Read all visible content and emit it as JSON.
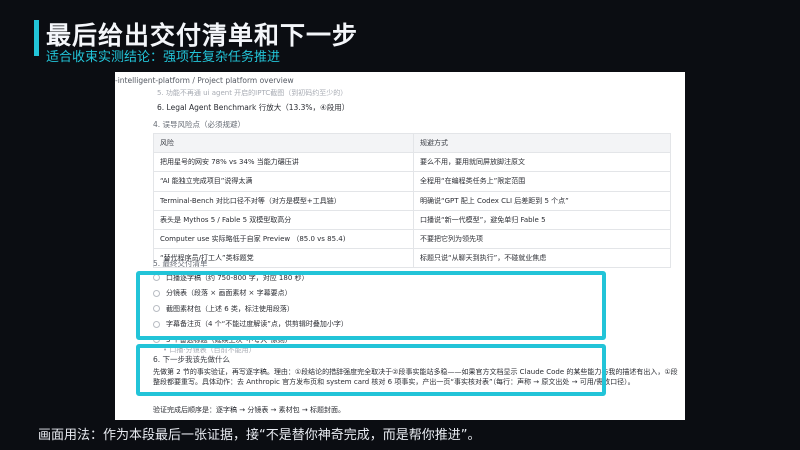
{
  "slide": {
    "title": "最后给出交付清单和下一步",
    "subtitle": "适合收束实测结论：强项在复杂任务推进",
    "caption": "画面用法：作为本段最后一张证据，接“不是替你神奇完成，而是帮你推进”。",
    "accent_color": "#22c4d8",
    "background_color": "#0b0d12"
  },
  "doc": {
    "breadcrumb": "-intelligent-platform / Project platform overview",
    "faded_line": "5. 功能不再通 ui agent 开启的IPTC截图（到初码约至少的）",
    "item6": "6. Legal Agent Benchmark 行放大（13.3%，④段用）",
    "section4_heading": "4. 误导风险点（必须规避）",
    "risk_table": {
      "headers": [
        "风险",
        "规避方式"
      ],
      "rows": [
        [
          "把用星号的网安 78% vs 34% 当能力碾压讲",
          "要么不用，要用就同屏放脚注原文"
        ],
        [
          "“AI 能独立完成项目”说得太满",
          "全程用“在编程类任务上”限定范围"
        ],
        [
          "Terminal-Bench 对比口径不对等（对方是模型+工具链）",
          "明确说“GPT 配上 Codex CLI 后差距到 5 个点”"
        ],
        [
          "表头是 Mythos 5 / Fable 5 双模型取高分",
          "口播说“新一代模型”，避免单归 Fable 5"
        ],
        [
          "Computer use 实际略低于自家 Preview （85.0 vs 85.4)",
          "不要把它列为领先项"
        ],
        [
          "“替代程序员/打工人”类标题党",
          "标题只说“从聊天到执行”，不碰就业焦虑"
        ]
      ]
    },
    "section5_heading": "5. 最终交付清单",
    "deliverables": [
      "口播逐字稿（约 750-800 字，对应 180 秒）",
      "分镜表（段落 × 画面素材 × 字幕要点）",
      "截图素材包（上述 6 类，标注使用段落）",
      "字幕备注页（4 个“不能过度解读”点，供剪辑时叠加小字）",
      "3 个备选标题（延续上次“不夸大”原则）"
    ],
    "below_item": "• 口播·分镜表（目前不能用）",
    "section6_heading": "6. 下一步我该先做什么",
    "paragraph": "先做第 2 节的事实验证，再写逐字稿。理由：①段结论的措辞强度完全取决于②段事实能站多稳——如果官方文档显示 Claude Code 的某些能力与我的描述有出入，①段整段都要重写。具体动作：去 Anthropic 官方发布页和 system card 核对 6 项事实，产出一页“事实核对表”（每行：声称 → 原文出处 → 可用/需改口径）。",
    "verify_line": "验证完成后顺序是：逐字稿 → 分镜表 → 素材包 → 标题封面。"
  }
}
